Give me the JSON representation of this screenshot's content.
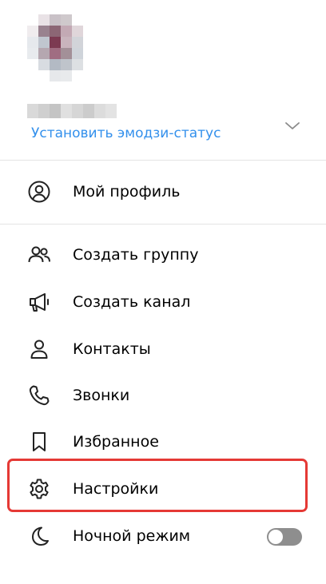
{
  "profile": {
    "avatar_pixels": [
      [
        "#ffffff",
        "#e9e2e6",
        "#c9c1c7",
        "#cfc9cc",
        "#ffffff",
        "#ffffff"
      ],
      [
        "#f0ecee",
        "#99828f",
        "#8c6675",
        "#c3a9b4",
        "#e0d6da",
        "#ffffff"
      ],
      [
        "#e6e9ed",
        "#c0c6cf",
        "#7c3a52",
        "#c9b4bd",
        "#d2d4d9",
        "#ffffff"
      ],
      [
        "#e8ebee",
        "#b5a7b0",
        "#a06d82",
        "#a39098",
        "#cfd4da",
        "#ffffff"
      ],
      [
        "#ffffff",
        "#d8dce1",
        "#b3bac4",
        "#bfc4cb",
        "#dde0e3",
        "#ffffff"
      ],
      [
        "#ffffff",
        "#ffffff",
        "#e6e8eb",
        "#e8eaec",
        "#ffffff",
        "#ffffff"
      ]
    ],
    "name_blur_pixels": [
      "#d9d9d9",
      "#cfcfcf",
      "#c4c4c4",
      "#e0e0e0",
      "#d6d6d6",
      "#cccccc",
      "#dcdcdc",
      "#e3e3e3"
    ],
    "emoji_status_label": "Установить эмодзи-статус",
    "expand_icon": "chevron-down-icon"
  },
  "menu": {
    "my_profile": {
      "label": "Мой профиль",
      "icon": "user-circle-icon"
    },
    "new_group": {
      "label": "Создать группу",
      "icon": "users-icon"
    },
    "new_channel": {
      "label": "Создать канал",
      "icon": "megaphone-icon"
    },
    "contacts": {
      "label": "Контакты",
      "icon": "user-icon"
    },
    "calls": {
      "label": "Звонки",
      "icon": "phone-icon"
    },
    "saved": {
      "label": "Избранное",
      "icon": "bookmark-icon"
    },
    "settings": {
      "label": "Настройки",
      "icon": "gear-icon"
    },
    "night_mode": {
      "label": "Ночной режим",
      "icon": "moon-icon",
      "enabled": false
    }
  },
  "colors": {
    "accent": "#3390ec",
    "highlight_border": "#e53935",
    "toggle_off": "#8e8e8e",
    "divider": "#e4e4e4"
  }
}
